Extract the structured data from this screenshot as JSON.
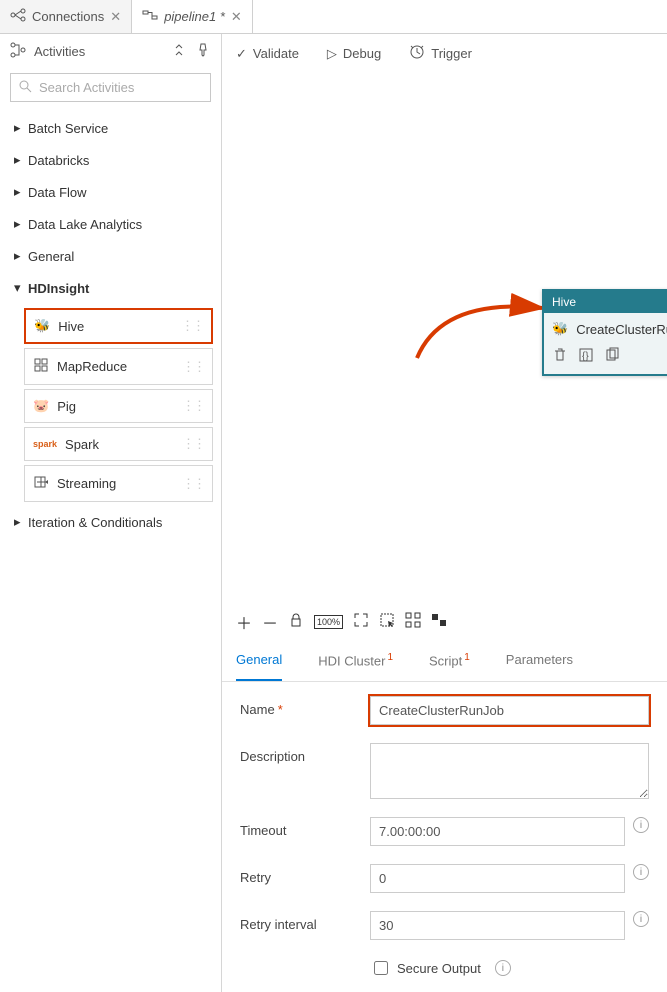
{
  "tabs": {
    "connections": "Connections",
    "pipeline": "pipeline1 *"
  },
  "sidebar": {
    "title": "Activities",
    "search_placeholder": "Search Activities",
    "groups": {
      "batch": "Batch Service",
      "databricks": "Databricks",
      "dataflow": "Data Flow",
      "dla": "Data Lake Analytics",
      "general": "General",
      "hdinsight": "HDInsight",
      "iteration": "Iteration & Conditionals"
    },
    "hdinsight_items": {
      "hive": "Hive",
      "mapreduce": "MapReduce",
      "pig": "Pig",
      "spark": "Spark",
      "streaming": "Streaming"
    }
  },
  "toolbar": {
    "validate": "Validate",
    "debug": "Debug",
    "trigger": "Trigger"
  },
  "node": {
    "type": "Hive",
    "name": "CreateClusterRunJob"
  },
  "propTabs": {
    "general": "General",
    "hdi": "HDI Cluster",
    "script": "Script",
    "parameters": "Parameters"
  },
  "form": {
    "name_label": "Name",
    "name_value": "CreateClusterRunJob",
    "desc_label": "Description",
    "desc_value": "",
    "timeout_label": "Timeout",
    "timeout_value": "7.00:00:00",
    "retry_label": "Retry",
    "retry_value": "0",
    "retry_interval_label": "Retry interval",
    "retry_interval_value": "30",
    "secure_output": "Secure Output"
  }
}
